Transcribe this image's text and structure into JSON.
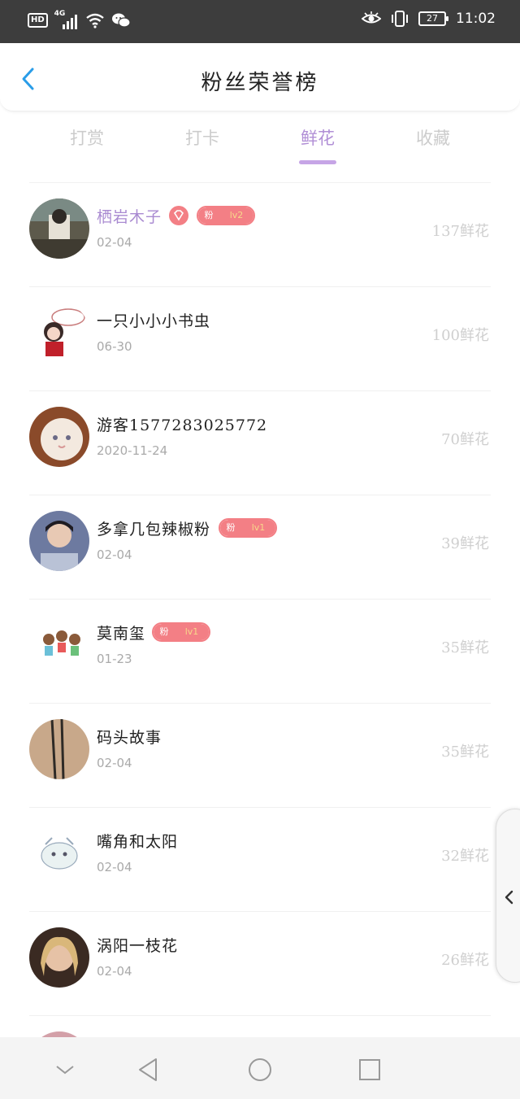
{
  "status_bar": {
    "hd": "HD",
    "network": "4G",
    "battery": "27",
    "time": "11:02"
  },
  "header": {
    "title": "粉丝荣誉榜"
  },
  "tabs": [
    {
      "label": "打赏",
      "active": false
    },
    {
      "label": "打卡",
      "active": false
    },
    {
      "label": "鲜花",
      "active": true
    },
    {
      "label": "收藏",
      "active": false
    }
  ],
  "badge_fan_label": "粉",
  "accent_color": "#b18fd6",
  "badge_color": "#f37f85",
  "list": [
    {
      "name": "栖岩木子",
      "date": "02-04",
      "count": "137鲜花",
      "badge": "lv2",
      "diamond": true
    },
    {
      "name": "一只小小小书虫",
      "date": "06-30",
      "count": "100鲜花",
      "badge": null,
      "diamond": false
    },
    {
      "name": "游客1577283025772",
      "date": "2020-11-24",
      "count": "70鲜花",
      "badge": null,
      "diamond": false
    },
    {
      "name": "多拿几包辣椒粉",
      "date": "02-04",
      "count": "39鲜花",
      "badge": "lv1",
      "diamond": false
    },
    {
      "name": "莫南玺",
      "date": "01-23",
      "count": "35鲜花",
      "badge": "lv1",
      "diamond": false
    },
    {
      "name": "码头故事",
      "date": "02-04",
      "count": "35鲜花",
      "badge": null,
      "diamond": false
    },
    {
      "name": "嘴角和太阳",
      "date": "02-04",
      "count": "32鲜花",
      "badge": null,
      "diamond": false
    },
    {
      "name": "涡阳一枝花",
      "date": "02-04",
      "count": "26鲜花",
      "badge": null,
      "diamond": false
    }
  ],
  "icons": {
    "back": "chevron-left-icon",
    "side": "chevron-left-icon",
    "nav": [
      "chevron-down-icon",
      "back-triangle-icon",
      "home-circle-icon",
      "recents-square-icon"
    ]
  }
}
